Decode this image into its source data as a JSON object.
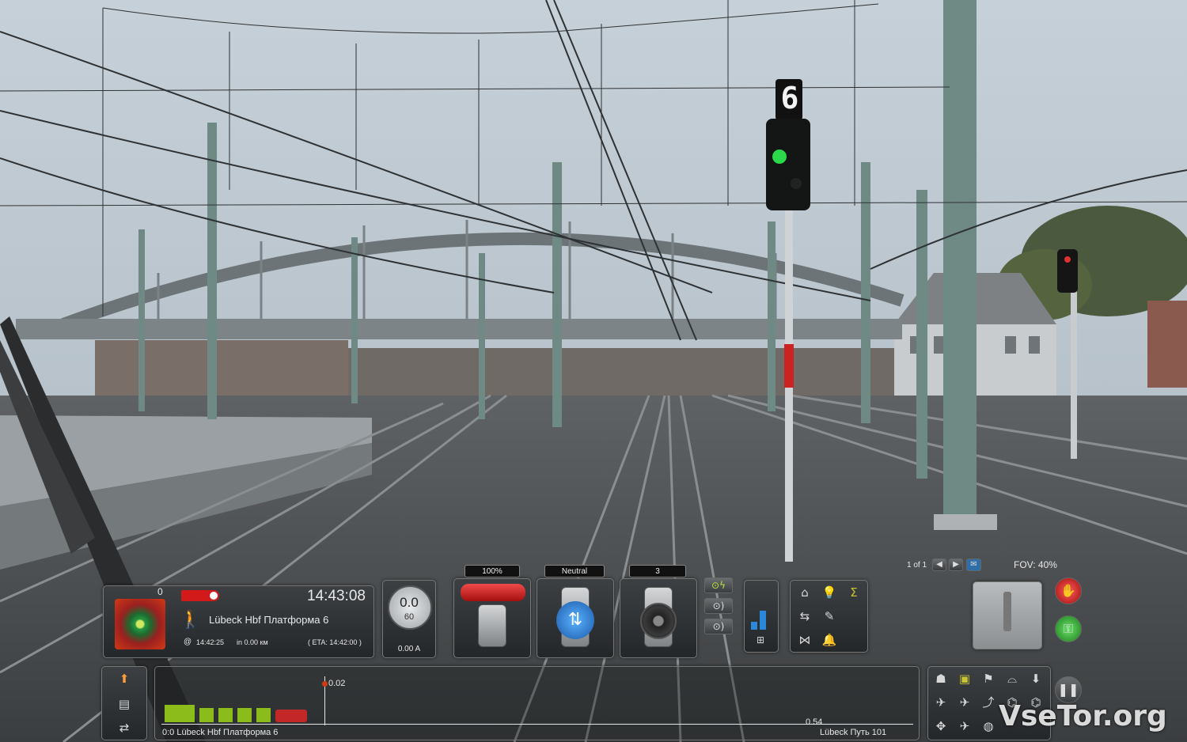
{
  "hud": {
    "counter": "0",
    "clock": "14:43:08",
    "next_stop": "Lübeck Hbf Платформа 6",
    "arrival_time": "14:42:25",
    "distance": "in 0.00 км",
    "eta": "( ETA: 14:42:00 )"
  },
  "speedo": {
    "speed": "0.0",
    "limit": "60",
    "amps": "0.00 A"
  },
  "controls": {
    "throttle_label": "100%",
    "reverser_label": "Neutral",
    "brake_label": "3"
  },
  "camera": {
    "page": "1 of 1",
    "fov": "FOV: 40%"
  },
  "track_monitor": {
    "marker_value": "0.02",
    "end_value": "0.54",
    "start_label": "0:0 Lübeck Hbf Платформа 6",
    "end_label": "Lübeck Путь 101"
  },
  "signal": {
    "route_indicator": "6",
    "aspect": "green"
  },
  "watermark": "VseTor.org",
  "colors": {
    "signal_green": "#2bd94a",
    "brake_red": "#d21a1a",
    "accent_yellow": "#c8c232"
  }
}
